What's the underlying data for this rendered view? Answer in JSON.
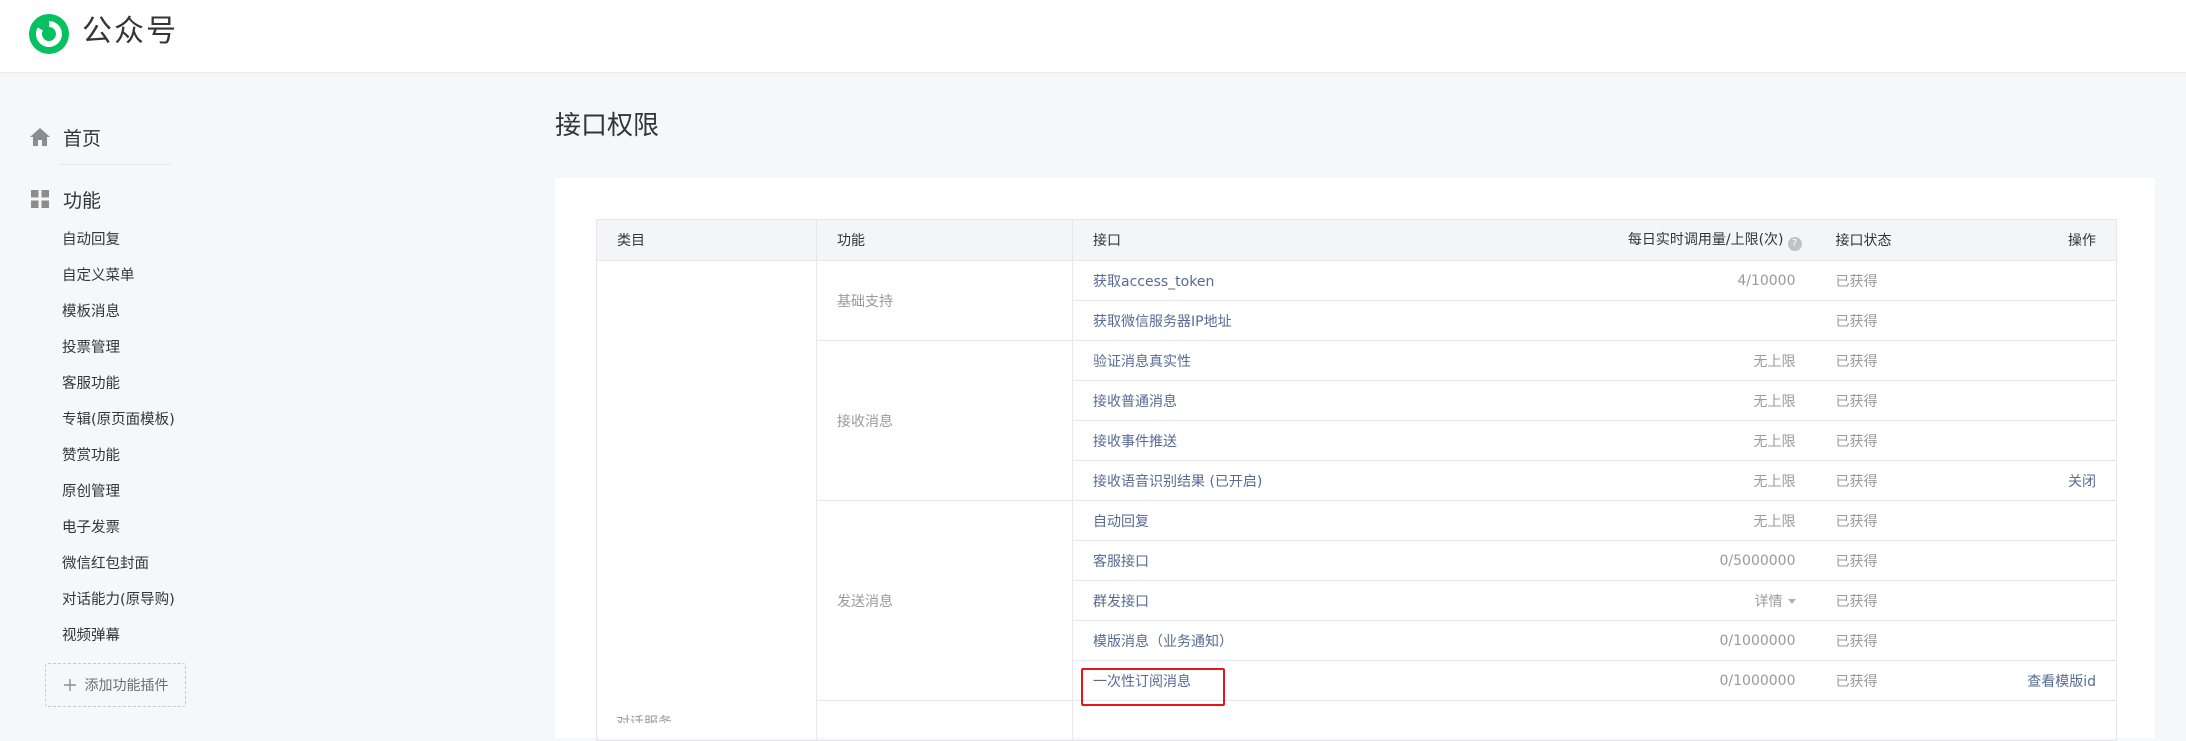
{
  "brand": {
    "name": "公众号",
    "accent": "#07c160"
  },
  "sidebar": {
    "home_label": "首页",
    "group_label": "功能",
    "items": [
      {
        "label": "自动回复"
      },
      {
        "label": "自定义菜单"
      },
      {
        "label": "模板消息"
      },
      {
        "label": "投票管理"
      },
      {
        "label": "客服功能"
      },
      {
        "label": "专辑(原页面模板)"
      },
      {
        "label": "赞赏功能"
      },
      {
        "label": "原创管理"
      },
      {
        "label": "电子发票"
      },
      {
        "label": "微信红包封面"
      },
      {
        "label": "对话能力(原导购)"
      },
      {
        "label": "视频弹幕"
      }
    ],
    "add_plugin_label": "添加功能插件"
  },
  "page": {
    "title": "接口权限"
  },
  "table": {
    "headers": {
      "category": "类目",
      "function": "功能",
      "interface": "接口",
      "quota": "每日实时调用量/上限(次)",
      "status": "接口状态",
      "operation": "操作"
    },
    "groups": [
      {
        "function": "基础支持",
        "rows": [
          {
            "interface": "获取access_token",
            "quota": "4/10000",
            "status": "已获得",
            "op": ""
          },
          {
            "interface": "获取微信服务器IP地址",
            "quota": "",
            "status": "已获得",
            "op": ""
          }
        ]
      },
      {
        "function": "接收消息",
        "rows": [
          {
            "interface": "验证消息真实性",
            "quota": "无上限",
            "status": "已获得",
            "op": ""
          },
          {
            "interface": "接收普通消息",
            "quota": "无上限",
            "status": "已获得",
            "op": ""
          },
          {
            "interface": "接收事件推送",
            "quota": "无上限",
            "status": "已获得",
            "op": ""
          },
          {
            "interface": "接收语音识别结果 (已开启)",
            "quota": "无上限",
            "status": "已获得",
            "op": "关闭"
          }
        ]
      },
      {
        "function": "发送消息",
        "rows": [
          {
            "interface": "自动回复",
            "quota": "无上限",
            "status": "已获得",
            "op": ""
          },
          {
            "interface": "客服接口",
            "quota": "0/5000000",
            "status": "已获得",
            "op": ""
          },
          {
            "interface": "群发接口",
            "quota": "详情",
            "status": "已获得",
            "op": ""
          },
          {
            "interface": "模版消息（业务通知）",
            "quota": "0/1000000",
            "status": "已获得",
            "op": ""
          },
          {
            "interface": "一次性订阅消息",
            "quota": "0/1000000",
            "status": "已获得",
            "op": "查看模版id"
          }
        ]
      }
    ],
    "category_partial": "对话服务"
  }
}
